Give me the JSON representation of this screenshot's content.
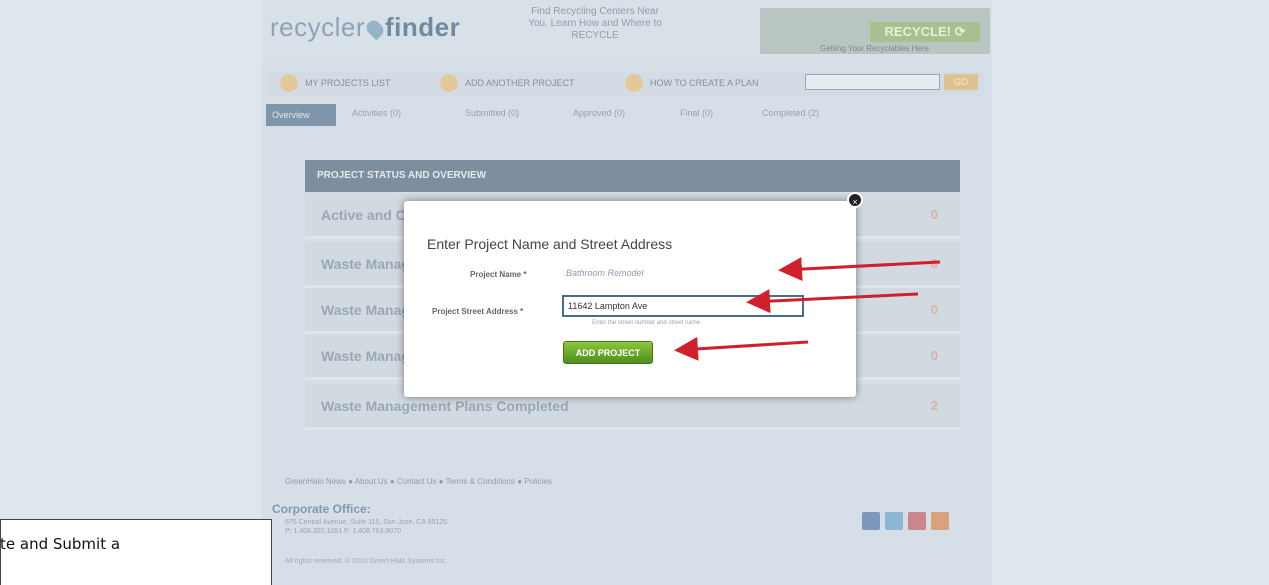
{
  "header": {
    "logo_part1": "recycler",
    "logo_part2": "finder",
    "tagline": "Find Recycling Centers Near You. Learn How and Where to RECYCLE",
    "banner_button": "RECYCLE! ⟳",
    "banner_sub": "Getting Your Recyclables Here"
  },
  "nav": {
    "items": [
      "MY PROJECTS LIST",
      "ADD ANOTHER PROJECT",
      "HOW TO CREATE A PLAN"
    ],
    "search_go": "GO"
  },
  "tabs": {
    "active": "Overview",
    "items": [
      "Activities (0)",
      "Submitted (0)",
      "Approved (0)",
      "Final (0)",
      "Completed (2)"
    ]
  },
  "panel": {
    "title": "PROJECT STATUS AND OVERVIEW",
    "rows": [
      {
        "label": "Active and Current Projects",
        "count": "0"
      },
      {
        "label": "Waste Management Plans Submitted",
        "count": "0"
      },
      {
        "label": "Waste Management Plans Approved",
        "count": "0"
      },
      {
        "label": "Waste Management Plans Final",
        "count": "0"
      },
      {
        "label": "Waste Management Plans Completed",
        "count": "2"
      }
    ]
  },
  "modal": {
    "title": "Enter Project Name and Street Address",
    "project_name_label": "Project Name *",
    "project_name_value": "Bathroom Remodel",
    "address_label": "Project Street Address *",
    "address_value": "11642 Lampton Ave",
    "address_hint": "Enter the street number and street name",
    "add_button": "ADD PROJECT",
    "close": "×"
  },
  "footer": {
    "links": "GreenHalo News  ●  About Us  ●  Contact Us  ●  Terms & Conditions  ●  Policies",
    "corp_title": "Corporate Office:",
    "corp_line1": "675 Central Avenue, Suite 115, San Jose, CA 95125",
    "corp_line2": "P: 1.408.320.1051  F: 1.408.763.9070",
    "rights": "All rights reserved. © 2010 Green Halo Systems Inc."
  },
  "caption": "te and Submit a",
  "colors": {
    "arrow": "#d0202e",
    "button_green": "#6aaa2a"
  }
}
